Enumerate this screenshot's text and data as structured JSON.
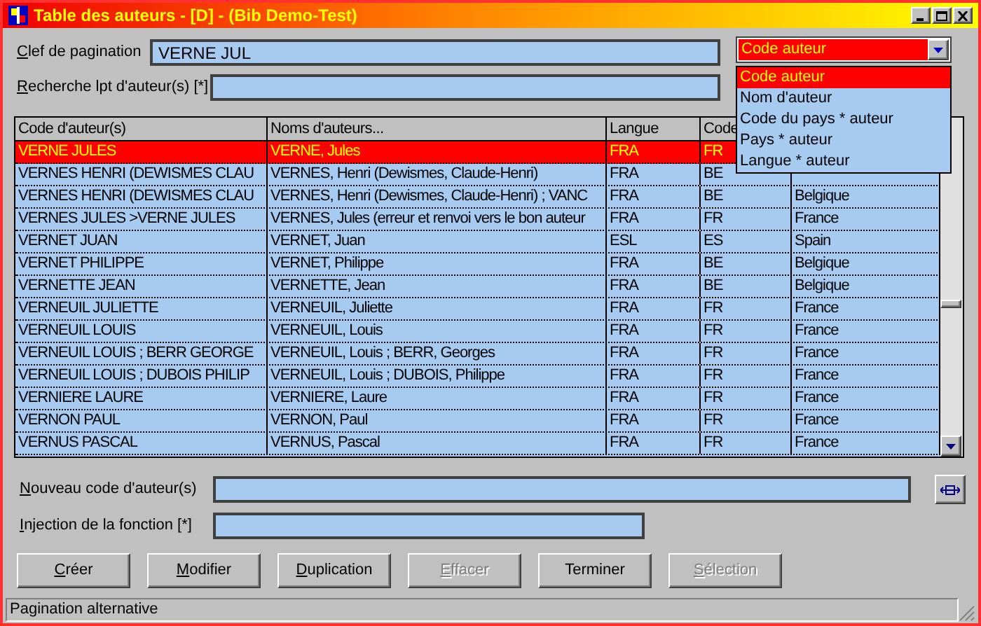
{
  "window": {
    "title": "Table des auteurs - [D] - (Bib Demo-Test)"
  },
  "fields": [
    {
      "label": "Clef de pagination",
      "mnemonic": true,
      "value": "VERNE JUL"
    },
    {
      "label": "Recherche lpt d'auteur(s) [*]",
      "mnemonic": true
    }
  ],
  "sort_combo": {
    "value": "Code auteur",
    "expanded": true,
    "options": [
      {
        "label": "Code auteur",
        "selected": true
      },
      {
        "label": "Nom d'auteur",
        "selected": false
      },
      {
        "label": "Code du pays * auteur",
        "selected": false
      },
      {
        "label": "Pays * auteur",
        "selected": false
      },
      {
        "label": "Langue * auteur",
        "selected": false
      }
    ]
  },
  "table": {
    "columns": [
      "Code d'auteur(s)",
      "Noms d'auteurs...",
      "Langue",
      "Code"
    ],
    "rows": [
      {
        "selected": true,
        "cells": [
          "VERNE JULES",
          "VERNE, Jules",
          "FRA",
          "FR"
        ]
      },
      {
        "selected": false,
        "cells": [
          "VERNES HENRI (DEWISMES CLAU",
          "VERNES, Henri (Dewismes, Claude-Henri)",
          "FRA",
          "BE"
        ]
      },
      {
        "selected": false,
        "cells": [
          "VERNES HENRI (DEWISMES CLAU",
          "VERNES, Henri (Dewismes, Claude-Henri) ; VANC",
          "FRA",
          "BE",
          "Belgique"
        ]
      },
      {
        "selected": false,
        "cells": [
          "VERNES JULES >VERNE JULES",
          "VERNES, Jules (erreur et renvoi vers le bon auteur",
          "FRA",
          "FR",
          "France"
        ]
      },
      {
        "selected": false,
        "cells": [
          "VERNET JUAN",
          "VERNET, Juan",
          "ESL",
          "ES",
          "Spain"
        ]
      },
      {
        "selected": false,
        "cells": [
          "VERNET PHILIPPE",
          "VERNET, Philippe",
          "FRA",
          "BE",
          "Belgique"
        ]
      },
      {
        "selected": false,
        "cells": [
          "VERNETTE JEAN",
          "VERNETTE, Jean",
          "FRA",
          "BE",
          "Belgique"
        ]
      },
      {
        "selected": false,
        "cells": [
          "VERNEUIL JULIETTE",
          "VERNEUIL, Juliette",
          "FRA",
          "FR",
          "France"
        ]
      },
      {
        "selected": false,
        "cells": [
          "VERNEUIL LOUIS",
          "VERNEUIL, Louis",
          "FRA",
          "FR",
          "France"
        ]
      },
      {
        "selected": false,
        "cells": [
          "VERNEUIL LOUIS ; BERR GEORGE",
          "VERNEUIL, Louis ; BERR, Georges",
          "FRA",
          "FR",
          "France"
        ]
      },
      {
        "selected": false,
        "cells": [
          "VERNEUIL LOUIS ; DUBOIS PHILIP",
          "VERNEUIL, Louis ; DUBOIS, Philippe",
          "FRA",
          "FR",
          "France"
        ]
      },
      {
        "selected": false,
        "cells": [
          "VERNIERE LAURE",
          "VERNIERE, Laure",
          "FRA",
          "FR",
          "France"
        ]
      },
      {
        "selected": false,
        "cells": [
          "VERNON PAUL",
          "VERNON, Paul",
          "FRA",
          "FR",
          "France"
        ]
      },
      {
        "selected": false,
        "cells": [
          "VERNUS PASCAL",
          "VERNUS, Pascal",
          "FRA",
          "FR",
          "France"
        ]
      }
    ]
  },
  "bottom_fields": [
    {
      "label": "Nouveau code d'auteur(s)",
      "mnemonic": true
    },
    {
      "label": "Injection de la fonction [*]",
      "mnemonic": true
    }
  ],
  "buttons": [
    {
      "label": "Créer",
      "mnemonic": true,
      "disabled": false
    },
    {
      "label": "Modifier",
      "mnemonic": true,
      "disabled": false
    },
    {
      "label": "Duplication",
      "mnemonic": true,
      "disabled": false
    },
    {
      "label": "Effacer",
      "mnemonic": true,
      "disabled": true
    },
    {
      "label": "Terminer",
      "mnemonic": false,
      "disabled": false
    },
    {
      "label": "Sélection",
      "mnemonic": true,
      "disabled": true
    }
  ],
  "status_bar": "Pagination alternative"
}
